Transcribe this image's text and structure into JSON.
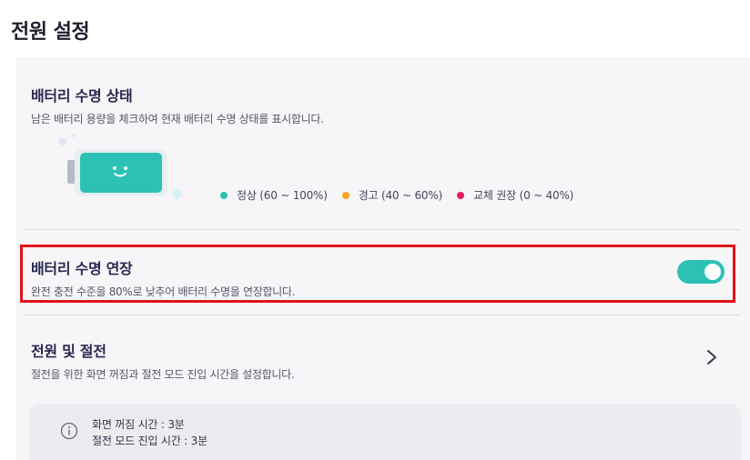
{
  "page": {
    "title": "전원 설정"
  },
  "battery_health": {
    "title": "배터리 수명 상태",
    "description": "남은 배터리 용량을 체크하여 현재 배터리 수명 상태를 표시합니다.",
    "face": "˘ ˘",
    "legend": [
      {
        "label": "정상 (60 ~ 100%)",
        "color": "#2cc1b4"
      },
      {
        "label": "경고 (40 ~ 60%)",
        "color": "#f5a623"
      },
      {
        "label": "교체 권장 (0 ~ 40%)",
        "color": "#e5195e"
      }
    ]
  },
  "battery_extend": {
    "title": "배터리 수명 연장",
    "description": "완전 충전 수준을 80%로 낮추어 배터리 수명을 연장합니다.",
    "toggle_on": true,
    "toggle_color": "#2cc1b4",
    "highlight_color": "#e0101a"
  },
  "power_saving": {
    "title": "전원 및 절전",
    "description": "절전을 위한 화면 꺼짐과 절전 모드 진입 시간을 설정합니다.",
    "info": {
      "screen_off": "화면 꺼짐 시간 : 3분",
      "sleep_mode": "절전 모드 진입 시간 : 3분"
    }
  }
}
